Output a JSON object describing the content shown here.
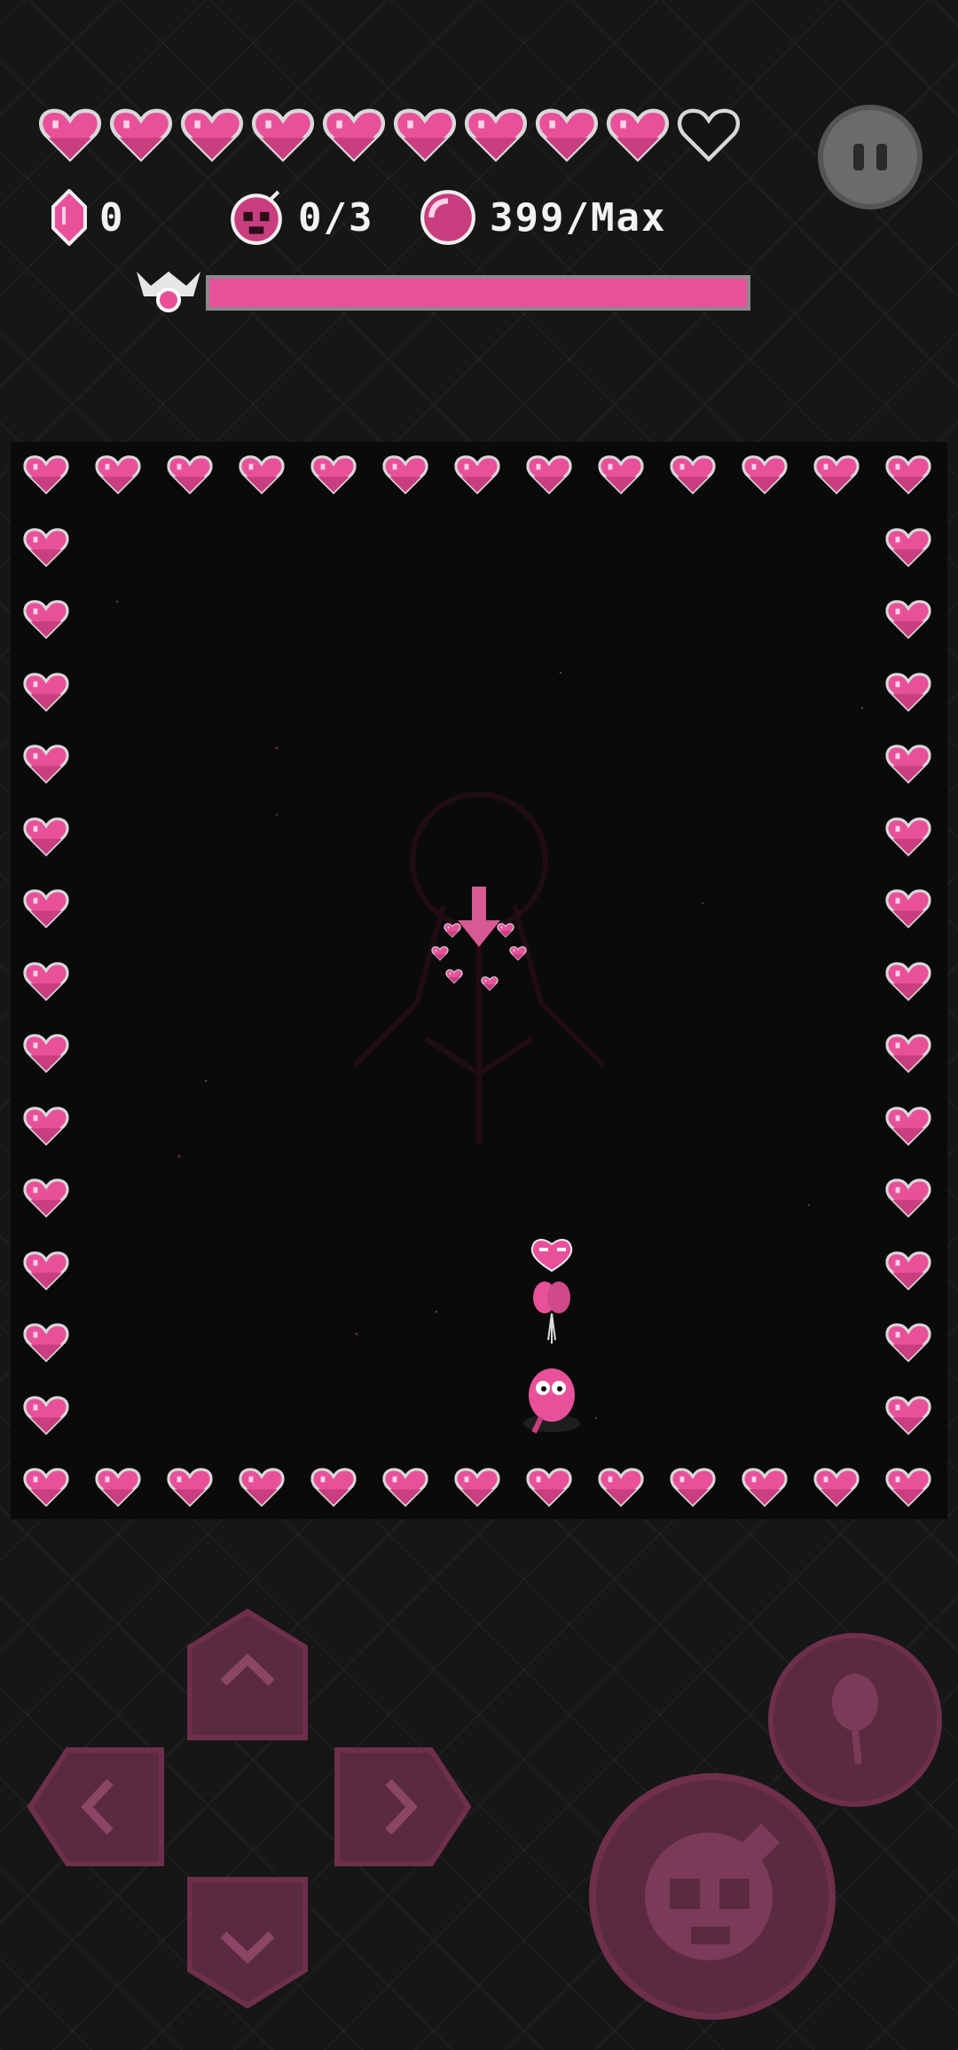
{
  "hud": {
    "health": {
      "filled": 9,
      "total": 10
    },
    "gems": {
      "icon": "gem-icon",
      "value": "0"
    },
    "bombs": {
      "icon": "skull-bomb-icon",
      "value": "0/3"
    },
    "orbs": {
      "icon": "pink-orb-icon",
      "value": "399/Max"
    },
    "pause": {
      "icon": "pause-icon"
    },
    "boss": {
      "icon": "boss-crown-icon",
      "health_fraction": 1.0
    }
  },
  "arena": {
    "border_icon": "heart-icon",
    "spawn_marker_icon": "down-arrow-hearts-icon",
    "player_icon": "pink-blob-with-balloons-icon"
  },
  "controls": {
    "dpad": [
      {
        "dir": "up",
        "icon": "chevron-up-icon"
      },
      {
        "dir": "left",
        "icon": "chevron-left-icon"
      },
      {
        "dir": "right",
        "icon": "chevron-right-icon"
      },
      {
        "dir": "down",
        "icon": "chevron-down-icon"
      }
    ],
    "balloon_button": {
      "icon": "balloon-icon"
    },
    "bomb_button": {
      "icon": "skull-bomb-icon"
    }
  },
  "colors": {
    "accent": "#e8519a",
    "heart_outline": "#cfcfcf",
    "button_fill": "#5a2a3e",
    "arena_bg": "#0a0a0a",
    "page_bg": "#161616"
  }
}
